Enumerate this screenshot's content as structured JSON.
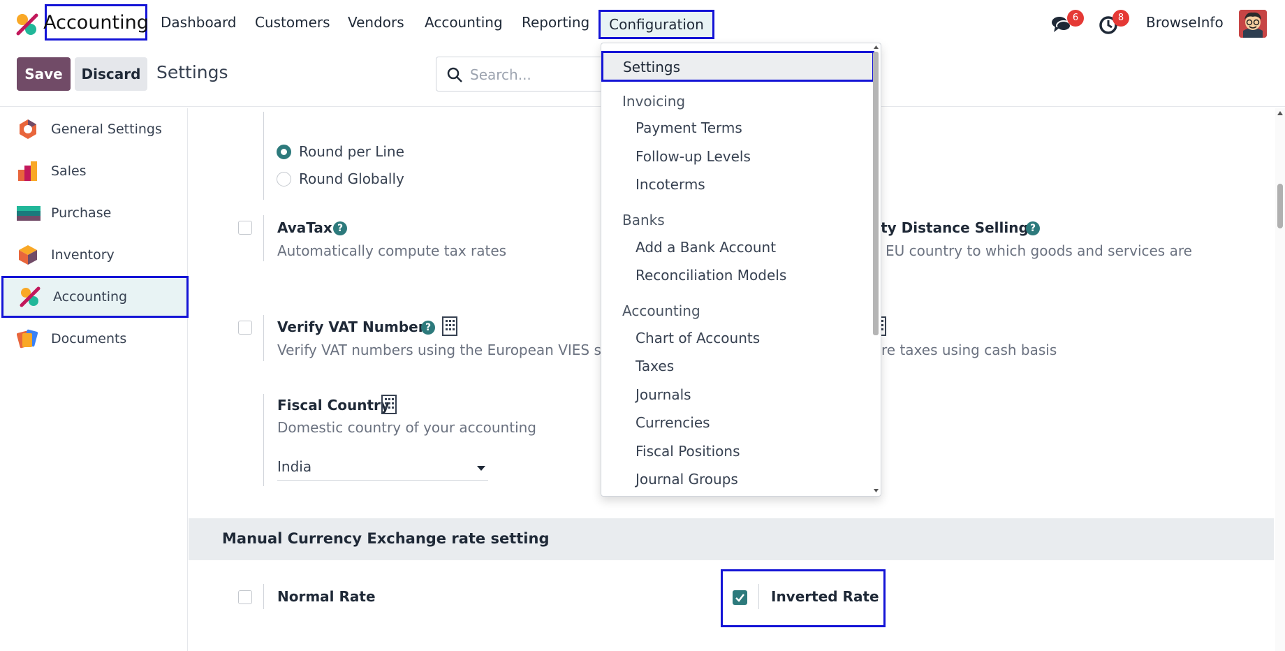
{
  "topnav": {
    "app_name": "Accounting",
    "menu": [
      "Dashboard",
      "Customers",
      "Vendors",
      "Accounting",
      "Reporting",
      "Configuration"
    ],
    "messages_badge": "6",
    "activities_badge": "8",
    "company": "BrowseInfo"
  },
  "control": {
    "save_label": "Save",
    "discard_label": "Discard",
    "breadcrumb": "Settings",
    "search_placeholder": "Search..."
  },
  "sidebar": {
    "items": [
      {
        "label": "General Settings",
        "icon": "general-settings-icon"
      },
      {
        "label": "Sales",
        "icon": "sales-icon"
      },
      {
        "label": "Purchase",
        "icon": "purchase-icon"
      },
      {
        "label": "Inventory",
        "icon": "inventory-icon"
      },
      {
        "label": "Accounting",
        "icon": "accounting-icon"
      },
      {
        "label": "Documents",
        "icon": "documents-icon"
      }
    ]
  },
  "main": {
    "rounding": {
      "opt1": "Round per Line",
      "opt2": "Round Globally",
      "selected": "Round per Line"
    },
    "avatax": {
      "title": "AvaTax",
      "desc": "Automatically compute tax rates"
    },
    "eu_distance": {
      "title": "nity Distance Selling",
      "desc": "EU country to which goods and services are"
    },
    "verify_vat": {
      "title": "Verify VAT Numbers",
      "desc": "Verify VAT numbers using the European VIES serv"
    },
    "cash_basis": {
      "desc": "re taxes using cash basis"
    },
    "fiscal_country": {
      "title": "Fiscal Country",
      "desc": "Domestic country of your accounting",
      "value": "India"
    },
    "section_title": "Manual Currency Exchange rate setting",
    "normal_rate": {
      "title": "Normal Rate",
      "checked": false
    },
    "inverted_rate": {
      "title": "Inverted Rate",
      "checked": true
    }
  },
  "dropdown": {
    "top_item": "Settings",
    "invoicing": {
      "header": "Invoicing",
      "items": [
        "Payment Terms",
        "Follow-up Levels",
        "Incoterms"
      ]
    },
    "banks": {
      "header": "Banks",
      "items": [
        "Add a Bank Account",
        "Reconciliation Models"
      ]
    },
    "accounting": {
      "header": "Accounting",
      "items": [
        "Chart of Accounts",
        "Taxes",
        "Journals",
        "Currencies",
        "Fiscal Positions",
        "Journal Groups"
      ]
    }
  },
  "colors": {
    "primary": "#714b67",
    "teal": "#017e84",
    "highlight": "#1414d6",
    "badge": "#e53935"
  }
}
